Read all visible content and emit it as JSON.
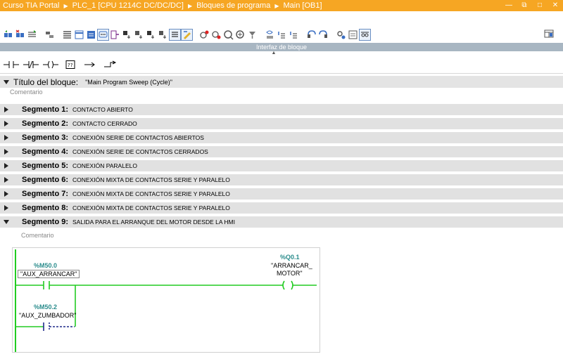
{
  "titlebar": {
    "crumbs": [
      "Curso TIA Portal",
      "PLC_1 [CPU 1214C DC/DC/DC]",
      "Bloques de programa",
      "Main [OB1]"
    ],
    "bg_color": "#f6a623"
  },
  "window_controls": [
    "minimize-icon",
    "restore-icon",
    "maximize-icon",
    "close-icon"
  ],
  "toolbar": {
    "icons": [
      "insert-network-icon",
      "delete-network-icon",
      "insert-row-icon",
      "append-row-icon",
      "absolute-operands-icon",
      "favorites-icon",
      "comments-icon",
      "expand-all-icon",
      "collapse-all-icon",
      "close-branch-icon",
      "jump-icon",
      "call-icon",
      "instruction-icon",
      "network-comments-icon",
      "toggle-comments-icon",
      "go-online-icon",
      "go-offline-icon",
      "monitor-icon",
      "monitor-all-icon",
      "modify-icon",
      "breakpoint-icon",
      "step-icon",
      "step-over-icon",
      "watch-icon",
      "force-icon",
      "trace-icon",
      "properties-icon"
    ]
  },
  "interface_bar": {
    "label": "Interfaz de bloque"
  },
  "lad_bar": {
    "items": [
      "normally-open-contact-icon",
      "normally-closed-contact-icon",
      "coil-icon",
      "empty-box-icon",
      "open-branch-icon",
      "close-branch-icon"
    ]
  },
  "block_title": {
    "label": "Título del bloque:",
    "value": "\"Main Program Sweep (Cycle)\"",
    "comment": "Comentario"
  },
  "segments": [
    {
      "label": "Segmento 1:",
      "title": "CONTACTO ABIERTO"
    },
    {
      "label": "Segmento 2:",
      "title": "CONTACTO CERRADO"
    },
    {
      "label": "Segmento 3:",
      "title": "CONEXIÓN SERIE DE CONTACTOS ABIERTOS"
    },
    {
      "label": "Segmento 4:",
      "title": "CONEXIÓN SERIE DE CONTACTOS CERRADOS"
    },
    {
      "label": "Segmento 5:",
      "title": "CONEXIÓN PARALELO"
    },
    {
      "label": "Segmento 6:",
      "title": "CONEXIÓN MIXTA DE CONTACTOS SERIE Y PARALELO"
    },
    {
      "label": "Segmento 7:",
      "title": "CONEXIÓN MIXTA DE CONTACTOS SERIE Y PARALELO"
    },
    {
      "label": "Segmento 8:",
      "title": "CONEXIÓN MIXTA DE CONTACTOS SERIE Y PARALELO"
    },
    {
      "label": "Segmento 9:",
      "title": "SALIDA PARA EL ARRANQUE DEL MOTOR DESDE LA HMI"
    }
  ],
  "segment9_comment": "Comentario",
  "network": {
    "contact1": {
      "address": "%M50.0",
      "symbol": "\"AUX_ARRANCAR\""
    },
    "contact2": {
      "address": "%M50.2",
      "symbol": "\"AUX_ZUMBADOR\""
    },
    "coil": {
      "address": "%Q0.1",
      "symbol_line1": "\"ARRANCAR_",
      "symbol_line2": "MOTOR\""
    },
    "rail_color": "#22cc22",
    "inactive_color": "#1f2a8a"
  }
}
